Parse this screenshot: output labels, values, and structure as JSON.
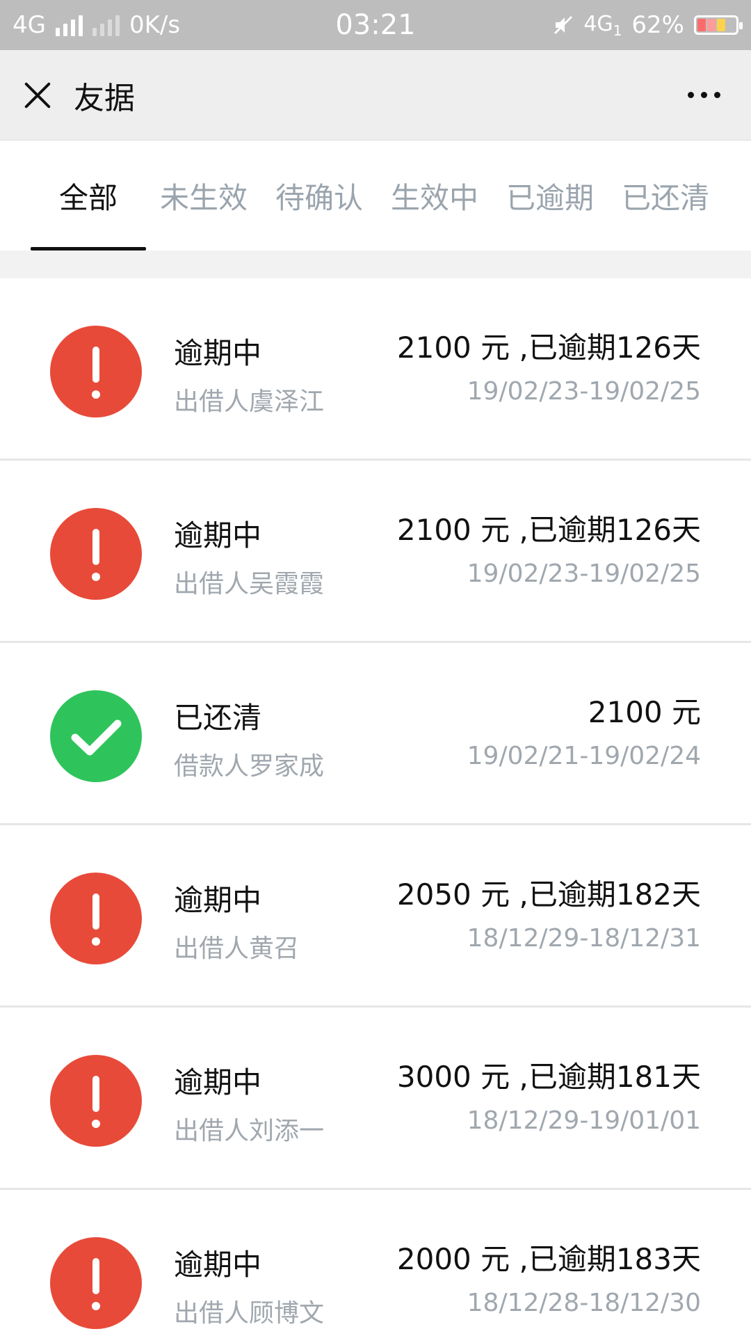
{
  "status_bar": {
    "network": "4G",
    "speed": "0K/s",
    "time": "03:21",
    "network_right": "4G",
    "network_right_sub": "1",
    "battery_level": "62%"
  },
  "nav": {
    "title": "友据"
  },
  "tabs": [
    {
      "label": "全部",
      "active": true
    },
    {
      "label": "未生效",
      "active": false
    },
    {
      "label": "待确认",
      "active": false
    },
    {
      "label": "生效中",
      "active": false
    },
    {
      "label": "已逾期",
      "active": false
    },
    {
      "label": "已还清",
      "active": false
    }
  ],
  "items": [
    {
      "status": "逾期中",
      "person": "出借人虞泽江",
      "amount": "2100 元 ,已逾期126天",
      "dates": "19/02/23-19/02/25",
      "icon": "exclamation-icon",
      "color": "#e84a39"
    },
    {
      "status": "逾期中",
      "person": "出借人吴霞霞",
      "amount": "2100 元 ,已逾期126天",
      "dates": "19/02/23-19/02/25",
      "icon": "exclamation-icon",
      "color": "#e84a39"
    },
    {
      "status": "已还清",
      "person": "借款人罗家成",
      "amount": "2100 元",
      "dates": "19/02/21-19/02/24",
      "icon": "check-icon",
      "color": "#2ec45b"
    },
    {
      "status": "逾期中",
      "person": "出借人黄召",
      "amount": "2050 元 ,已逾期182天",
      "dates": "18/12/29-18/12/31",
      "icon": "exclamation-icon",
      "color": "#e84a39"
    },
    {
      "status": "逾期中",
      "person": "出借人刘添一",
      "amount": "3000 元 ,已逾期181天",
      "dates": "18/12/29-19/01/01",
      "icon": "exclamation-icon",
      "color": "#e84a39"
    },
    {
      "status": "逾期中",
      "person": "出借人顾博文",
      "amount": "2000 元 ,已逾期183天",
      "dates": "18/12/28-18/12/30",
      "icon": "exclamation-icon",
      "color": "#e84a39"
    }
  ]
}
